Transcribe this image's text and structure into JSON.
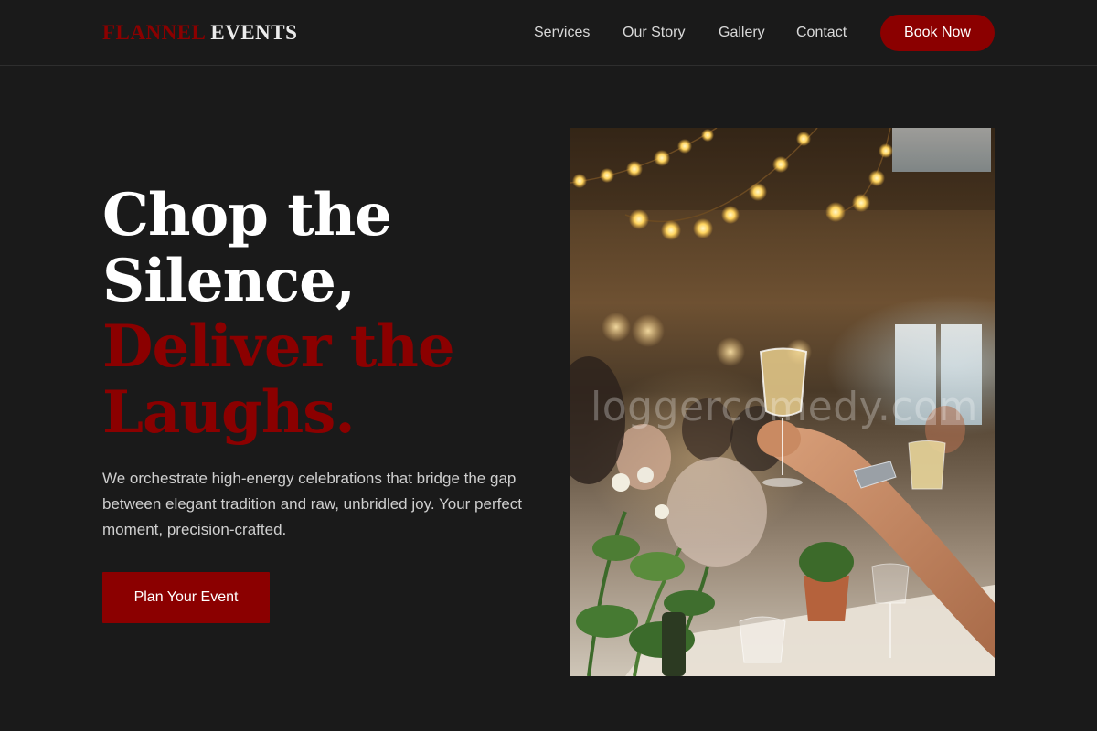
{
  "brand": {
    "part1": "FLANNEL",
    "part2": "EVENTS"
  },
  "nav": {
    "links": [
      {
        "label": "Services"
      },
      {
        "label": "Our Story"
      },
      {
        "label": "Gallery"
      },
      {
        "label": "Contact"
      }
    ],
    "cta_label": "Book Now"
  },
  "hero": {
    "title_line1": "Chop the",
    "title_line2": "Silence,",
    "title_line3": "Deliver the",
    "title_line4": "Laughs.",
    "description": "We orchestrate high-energy celebrations that bridge the gap between elegant tradition and raw, unbridled joy. Your perfect moment, precision-crafted.",
    "cta_label": "Plan Your Event",
    "image_watermark": "loggercomedy.com"
  },
  "colors": {
    "background": "#1a1a1a",
    "accent": "#8b0000",
    "text": "#ffffff",
    "muted_text": "#cfcfcf"
  }
}
